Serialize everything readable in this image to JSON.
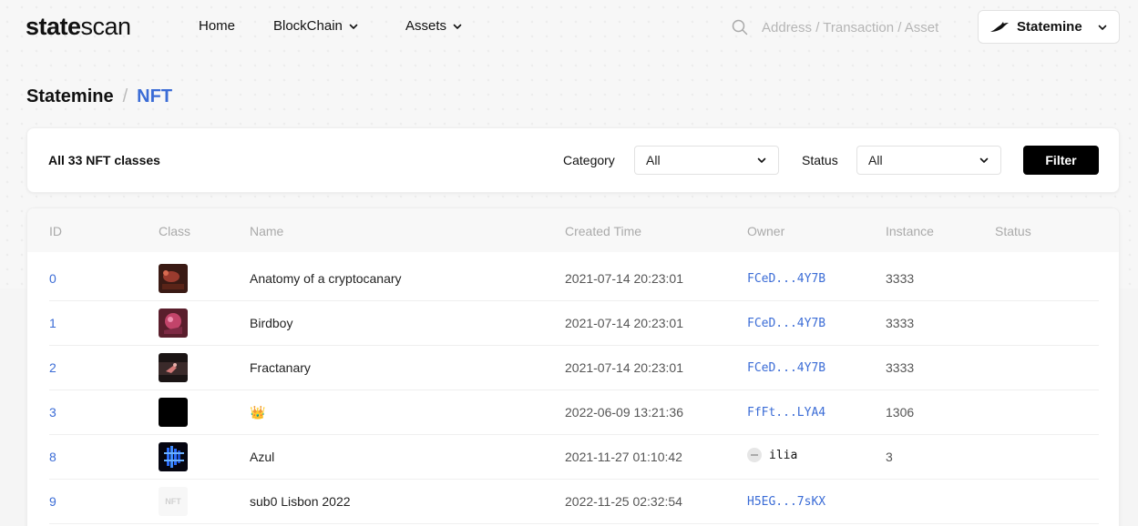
{
  "header": {
    "logo_bold": "state",
    "logo_light": "scan",
    "nav": [
      {
        "label": "Home",
        "dropdown": false
      },
      {
        "label": "BlockChain",
        "dropdown": true
      },
      {
        "label": "Assets",
        "dropdown": true
      }
    ],
    "search_placeholder": "Address / Transaction / Asset",
    "chain_name": "Statemine",
    "search_icon": "search-icon",
    "chain_icon": "bird-logo-icon"
  },
  "breadcrumb": {
    "root": "Statemine",
    "separator": "/",
    "current": "NFT"
  },
  "filter": {
    "count_text": "All 33 NFT classes",
    "category_label": "Category",
    "category_value": "All",
    "status_label": "Status",
    "status_value": "All",
    "button_label": "Filter"
  },
  "table": {
    "columns": [
      "ID",
      "Class",
      "Name",
      "Created Time",
      "Owner",
      "Instance",
      "Status"
    ],
    "rows": [
      {
        "id": "0",
        "name": "Anatomy of a cryptocanary",
        "created": "2021-07-14 20:23:01",
        "owner": "FCeD...4Y7B",
        "instance": "3333",
        "status": "",
        "thumb": "canary-red"
      },
      {
        "id": "1",
        "name": "Birdboy",
        "created": "2021-07-14 20:23:01",
        "owner": "FCeD...4Y7B",
        "instance": "3333",
        "status": "",
        "thumb": "birdboy-pink"
      },
      {
        "id": "2",
        "name": "Fractanary",
        "created": "2021-07-14 20:23:01",
        "owner": "FCeD...4Y7B",
        "instance": "3333",
        "status": "",
        "thumb": "fractanary-dark"
      },
      {
        "id": "3",
        "name": "👑",
        "created": "2022-06-09 13:21:36",
        "owner": "FfFt...LYA4",
        "instance": "1306",
        "status": "",
        "thumb": "black"
      },
      {
        "id": "8",
        "name": "Azul",
        "created": "2021-11-27 01:10:42",
        "owner": "ilia",
        "owner_named": true,
        "instance": "3",
        "status": "",
        "thumb": "azul-blue"
      },
      {
        "id": "9",
        "name": "sub0 Lisbon 2022",
        "created": "2022-11-25 02:32:54",
        "owner": "H5EG...7sKX",
        "instance": "",
        "status": "",
        "thumb": "nft-placeholder",
        "thumb_text": "NFT"
      }
    ]
  },
  "colors": {
    "link": "#3b6cd6",
    "primary_button": "#000000"
  }
}
